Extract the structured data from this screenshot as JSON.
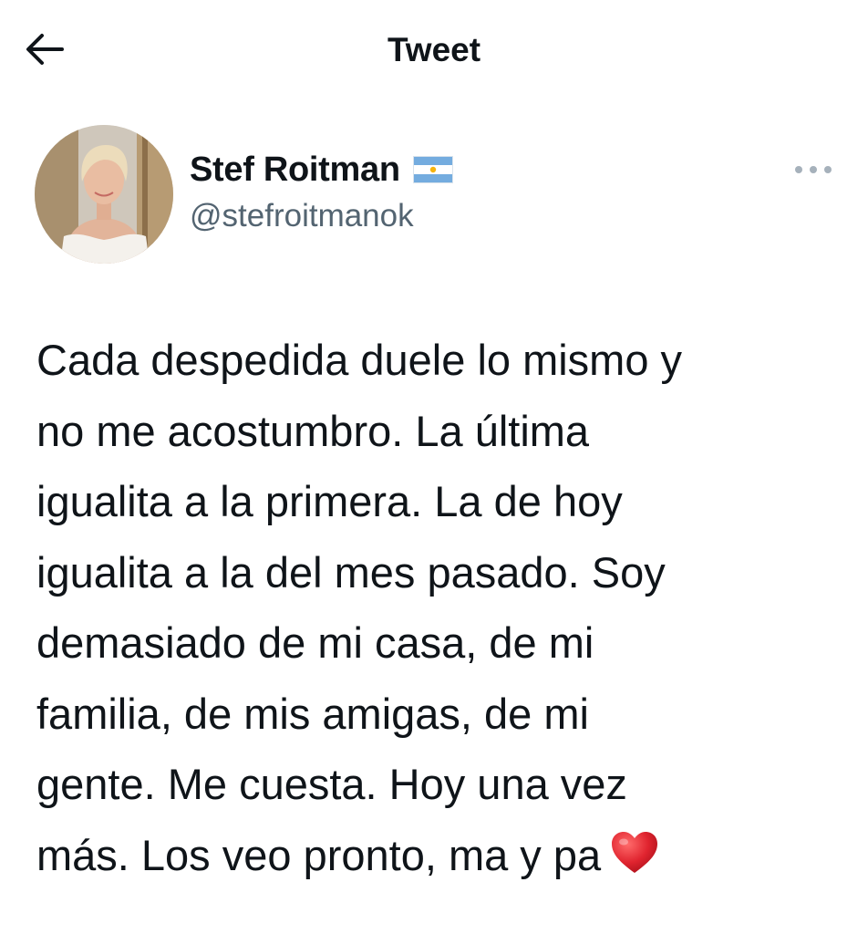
{
  "header": {
    "title": "Tweet",
    "back_icon": "arrow-left-icon"
  },
  "author": {
    "display_name": "Stef Roitman",
    "flag_icon": "argentina-flag-icon",
    "handle": "@stefroitmanok",
    "avatar_icon": "profile-photo"
  },
  "more_icon": "more-horizontal-icon",
  "tweet": {
    "text": "Cada despedida duele lo mismo y\nno me acostumbro. La última\nigualita a la primera. La de hoy\nigualita a la del mes pasado. Soy\ndemasiado de mi casa, de mi\nfamilia, de mis amigas, de mi\ngente. Me cuesta. Hoy una vez\nmás. Los veo pronto, ma y pa",
    "emoji_icon": "red-heart-icon"
  },
  "colors": {
    "text_primary": "#0f1419",
    "text_secondary": "#536471",
    "heart": "#e0242f",
    "flag_blue": "#74acdf"
  }
}
